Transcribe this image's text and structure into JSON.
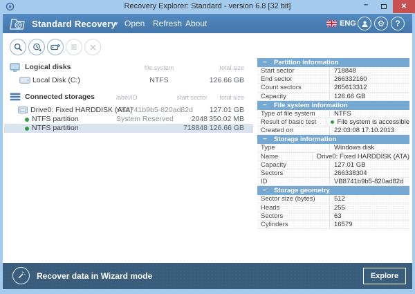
{
  "window": {
    "title": "Recovery Explorer: Standard - version 6.8 [32 bit]",
    "controls": {
      "minimize": "–",
      "maximize": "",
      "close": "✕"
    }
  },
  "header": {
    "app_name": "Standard Recovery",
    "menus": [
      {
        "label": "Open"
      },
      {
        "label": "Refresh"
      },
      {
        "label": "About"
      }
    ],
    "language": "ENG",
    "icon_buttons": [
      "user-icon",
      "gear-icon",
      "help-icon"
    ]
  },
  "toolbar": {
    "icons": [
      {
        "name": "scan-search-icon",
        "enabled": true
      },
      {
        "name": "recent-scan-icon",
        "enabled": true
      },
      {
        "name": "disk-image-icon",
        "enabled": true
      },
      {
        "name": "task-list-icon",
        "enabled": false
      },
      {
        "name": "close-task-icon",
        "enabled": false
      }
    ]
  },
  "logical_disks": {
    "title": "Logical disks",
    "columns": [
      "file system",
      "total size"
    ],
    "rows": [
      {
        "name": "Local Disk (C:)",
        "file_system": "NTFS",
        "total_size": "126.66 GB"
      }
    ]
  },
  "connected_storages": {
    "title": "Connected storages",
    "columns": [
      "label/ID",
      "start sector",
      "total size"
    ],
    "rows": [
      {
        "name": "Drive0: Fixed HARDDISK (ATA)",
        "label_id": "VB8741b9b5-820ad82d",
        "start_sector": "",
        "total_size": "127.01 GB"
      },
      {
        "name": "NTFS partition",
        "label_id": "System Reserved",
        "start_sector": "2048",
        "total_size": "350.02 MB"
      },
      {
        "name": "NTFS partition",
        "label_id": "",
        "start_sector": "718848",
        "total_size": "126.66 GB"
      }
    ],
    "selected_row_index": 2
  },
  "details": {
    "sections": [
      {
        "title": "Partition information",
        "rows": [
          {
            "label": "Start sector",
            "value": "718848"
          },
          {
            "label": "End sector",
            "value": "266332160"
          },
          {
            "label": "Count sectors",
            "value": "265613312"
          },
          {
            "label": "Capacity",
            "value": "126.66 GB"
          }
        ]
      },
      {
        "title": "File system information",
        "rows": [
          {
            "label": "Type of file system",
            "value": "NTFS"
          },
          {
            "label": "Result of basic test",
            "value": "File system is accessible"
          },
          {
            "label": "Created on",
            "value": "22:03:08 17.10.2013"
          }
        ]
      },
      {
        "title": "Storage information",
        "rows": [
          {
            "label": "Type",
            "value": "Windows disk"
          },
          {
            "label": "Name",
            "value": "Drive0: Fixed HARDDISK (ATA)"
          },
          {
            "label": "Capacity",
            "value": "127.01 GB"
          },
          {
            "label": "Sectors",
            "value": "266338304"
          },
          {
            "label": "ID",
            "value": "VB8741b9b5-820ad82d"
          }
        ]
      },
      {
        "title": "Storage geometry",
        "rows": [
          {
            "label": "Sector size (bytes)",
            "value": "512"
          },
          {
            "label": "Heads",
            "value": "255"
          },
          {
            "label": "Sectors",
            "value": "63"
          },
          {
            "label": "Cylinders",
            "value": "16579"
          }
        ]
      }
    ]
  },
  "footer": {
    "wizard_label": "Recover data in Wizard mode",
    "explore_button": "Explore"
  },
  "colors": {
    "header_blue": "#4a7db3",
    "titlebar_blue": "#a4cbed",
    "section_header_blue": "#76a8d4",
    "footer_blue": "#3a5d7c",
    "selected_row": "#d9e3ee",
    "status_green": "#2f9e44",
    "close_red": "#c75050"
  }
}
